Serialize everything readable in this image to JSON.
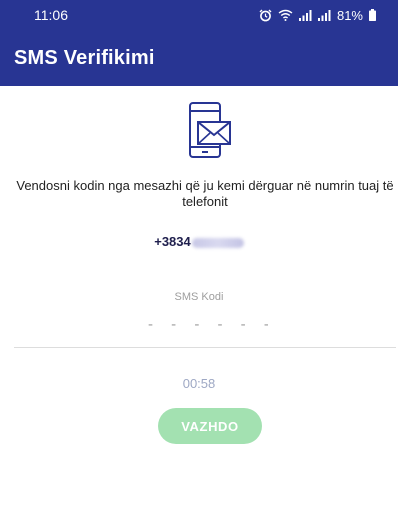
{
  "status_bar": {
    "time": "11:06",
    "battery_text": "81%",
    "icons": [
      "alarm-icon",
      "wifi-icon",
      "signal-icon",
      "signal-icon",
      "battery-icon"
    ]
  },
  "app_bar": {
    "title": "SMS Verifikimi"
  },
  "verification": {
    "icon": "mail-phone-icon",
    "instruction": "Vendosni kodin nga mesazhi që ju kemi dërguar në numrin tuaj të telefonit",
    "phone_number_visible": "+3834",
    "code_label": "SMS Kodi",
    "code_value": "",
    "code_placeholder": "- - - - - -",
    "timer": "00:58",
    "continue_label": "VAZHDO"
  },
  "colors": {
    "primary": "#283593",
    "button_disabled": "#a3e1b1",
    "timer": "#9ea8c4"
  }
}
